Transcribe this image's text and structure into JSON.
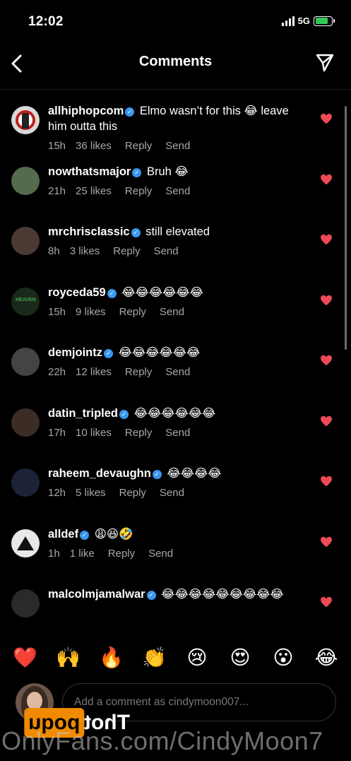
{
  "status_bar": {
    "time": "12:02",
    "network": "5G",
    "battery_level": 0.78
  },
  "header": {
    "title": "Comments",
    "back_icon": "chevron-left-icon",
    "share_icon": "paper-plane-icon"
  },
  "colors": {
    "heart": "#ed4956",
    "verified": "#3897f0",
    "meta": "#a8a8a8"
  },
  "comments": [
    {
      "username": "allhiphopcom",
      "text": "Elmo wasn’t for this 😂 leave him outta this",
      "time": "15h",
      "likes": "36 likes",
      "reply": "Reply",
      "send": "Send"
    },
    {
      "username": "nowthatsmajor",
      "text": "Bruh 😂",
      "time": "21h",
      "likes": "25 likes",
      "reply": "Reply",
      "send": "Send"
    },
    {
      "username": "mrchrisclassic",
      "text": "still elevated",
      "time": "8h",
      "likes": "3 likes",
      "reply": "Reply",
      "send": "Send"
    },
    {
      "username": "royceda59",
      "text": "😂😂😂😂😂😂",
      "time": "15h",
      "likes": "9 likes",
      "reply": "Reply",
      "send": "Send"
    },
    {
      "username": "demjointz",
      "text": "😂😂😂😂😂😂",
      "time": "22h",
      "likes": "12 likes",
      "reply": "Reply",
      "send": "Send"
    },
    {
      "username": "datin_tripled",
      "text": "😂😂😂😂😂😂",
      "time": "17h",
      "likes": "10 likes",
      "reply": "Reply",
      "send": "Send"
    },
    {
      "username": "raheem_devaughn",
      "text": "😂😂😂😂",
      "time": "12h",
      "likes": "5 likes",
      "reply": "Reply",
      "send": "Send"
    },
    {
      "username": "alldef",
      "text": "😩😆🤣",
      "time": "1h",
      "likes": "1 like",
      "reply": "Reply",
      "send": "Send"
    },
    {
      "username": "malcolmjamalwar",
      "text": "😂😂😂😂😂😂😂😂😂",
      "time": "",
      "likes": "",
      "reply": "",
      "send": ""
    }
  ],
  "emoji_bar": [
    "❤️",
    "🙌",
    "🔥",
    "👏",
    "😢",
    "😍",
    "😮",
    "😂"
  ],
  "composer": {
    "placeholder": "Add a comment as cindymoon007..."
  },
  "watermark": {
    "badge_left": "Thot",
    "badge_right": "poqu",
    "url": "OnlyFans.com/CindyMoon7"
  }
}
